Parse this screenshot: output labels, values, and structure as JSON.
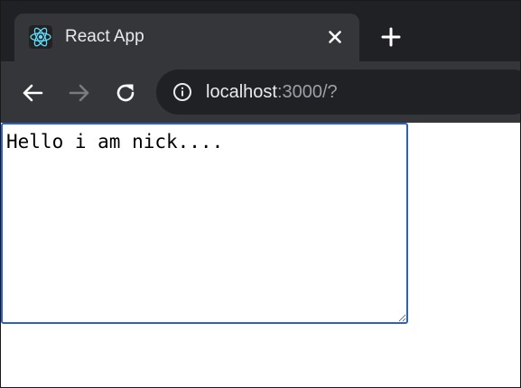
{
  "browser": {
    "tab": {
      "title": "React App",
      "favicon": "react-logo-icon"
    },
    "tab_close_icon": "close-icon",
    "new_tab_icon": "plus-icon",
    "nav": {
      "back_icon": "arrow-left-icon",
      "forward_icon": "arrow-right-icon",
      "reload_icon": "reload-icon"
    },
    "address_bar": {
      "info_icon": "info-icon",
      "host": "localhost",
      "rest": ":3000/?"
    }
  },
  "page": {
    "textarea": {
      "value": "Hello i am nick...."
    }
  },
  "colors": {
    "tabstrip_bg": "#202124",
    "tab_bg": "#35363a",
    "omnibox_bg": "#202124",
    "text_primary": "#e8eaed",
    "text_secondary": "#9aa0a6",
    "focus_ring": "#2f5fbf",
    "react_blue": "#61dafb"
  }
}
